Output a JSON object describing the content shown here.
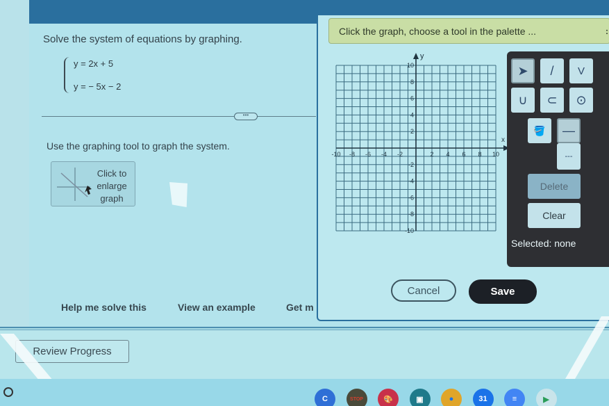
{
  "question": {
    "title": "Solve the system of equations by graphing.",
    "equations": [
      "y = 2x + 5",
      "y = − 5x − 2"
    ],
    "more_label": "•••",
    "instruction": "Use the graphing tool to graph the system.",
    "enlarge_label_lines": [
      "Click to",
      "enlarge",
      "graph"
    ]
  },
  "dialog": {
    "hint": "Click the graph, choose a tool in the palette ...",
    "hint_mark": ":",
    "palette": {
      "tools": [
        {
          "name": "select-tool",
          "glyph": "➤",
          "selected": true
        },
        {
          "name": "line-tool",
          "glyph": "/"
        },
        {
          "name": "absolute-value-tool",
          "glyph": "V"
        },
        {
          "name": "parabola-tool",
          "glyph": "∪"
        },
        {
          "name": "horizontal-parabola-tool",
          "glyph": "⊂"
        },
        {
          "name": "circle-tool",
          "glyph": "⊙"
        },
        {
          "name": "fill-tool",
          "glyph": "🪣"
        },
        {
          "name": "solid-line-style",
          "glyph": "—",
          "selected": true
        },
        {
          "name": "dashed-line-style",
          "glyph": "---"
        }
      ],
      "delete_label": "Delete",
      "clear_label": "Clear",
      "selected_text": "Selected: none"
    },
    "cancel_label": "Cancel",
    "save_label": "Save"
  },
  "chart_data": {
    "type": "scatter",
    "title": "",
    "xlabel": "x",
    "ylabel": "y",
    "xlim": [
      -10,
      10
    ],
    "ylim": [
      -10,
      10
    ],
    "grid": true,
    "x_ticks": [
      -10,
      -8,
      -6,
      -4,
      -2,
      2,
      4,
      6,
      8,
      10
    ],
    "y_ticks": [
      10,
      8,
      6,
      4,
      2,
      -2,
      -4,
      -6,
      -8,
      -10
    ],
    "series": []
  },
  "footer_links": [
    "Help me solve this",
    "View an example",
    "Get m"
  ],
  "review_label": "Review Progress",
  "shelf": {
    "apps": [
      {
        "name": "app-c",
        "glyph": "C",
        "bg": "#2f6fd6",
        "fg": "#ffffff"
      },
      {
        "name": "app-stop",
        "glyph": "STOP",
        "bg": "#4a4a3a",
        "fg": "#d6402e"
      },
      {
        "name": "app-paint",
        "glyph": "🎨",
        "bg": "#c8314a",
        "fg": "#ffffff"
      },
      {
        "name": "app-classroom",
        "glyph": "▣",
        "bg": "#1f7a8a",
        "fg": "#ffffff"
      },
      {
        "name": "app-chrome",
        "glyph": "●",
        "bg": "#e0a52a",
        "fg": "#1a73e8"
      },
      {
        "name": "app-calendar",
        "glyph": "31",
        "bg": "#1a73e8",
        "fg": "#ffffff"
      },
      {
        "name": "app-docs",
        "glyph": "≡",
        "bg": "#4285f4",
        "fg": "#ffffff"
      },
      {
        "name": "app-play",
        "glyph": "▶",
        "bg": "#c9e4ea",
        "fg": "#2a9d58"
      }
    ]
  }
}
